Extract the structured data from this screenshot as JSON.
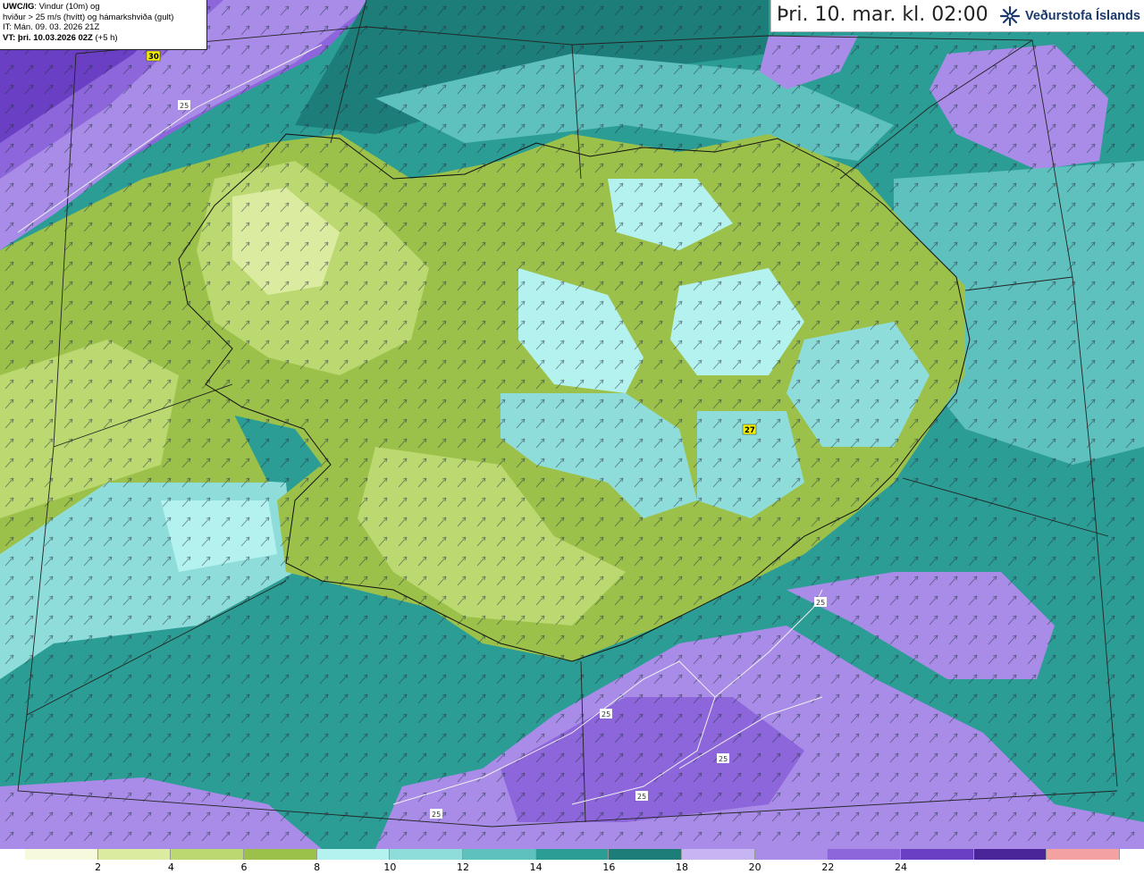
{
  "info": {
    "model": "UWC/IG",
    "model_desc": ": Vindur (10m) og",
    "line2": "hviður > 25 m/s (hvítt) og hámarkshviða (gult)",
    "it": "IT: Mán. 09. 03. 2026 21Z",
    "vt_label": "VT: þri. 10.03.2026 02Z",
    "vt_offset": " (+5 h)"
  },
  "title": "Þri. 10. mar. kl. 02:00",
  "logo_text": "Veðurstofa Íslands",
  "max_gust_labels": [
    "30",
    "27"
  ],
  "contour_labels": [
    "25",
    "25",
    "25",
    "25",
    "25",
    "25"
  ],
  "legend": {
    "colors": [
      "#f7f9dc",
      "#dbeb9f",
      "#bcd870",
      "#9cc14a",
      "#b4f2ef",
      "#8fdddb",
      "#5ec1bd",
      "#2b9d94",
      "#1c7d79",
      "#c6b5f2",
      "#a98ce8",
      "#8d66db",
      "#6b3fc4",
      "#4a2599",
      "#f4a1a1"
    ],
    "ticks": [
      "2",
      "4",
      "6",
      "8",
      "10",
      "12",
      "14",
      "16",
      "18",
      "20",
      "22",
      "24"
    ]
  },
  "wind_arrows": {
    "direction": "northeast"
  }
}
